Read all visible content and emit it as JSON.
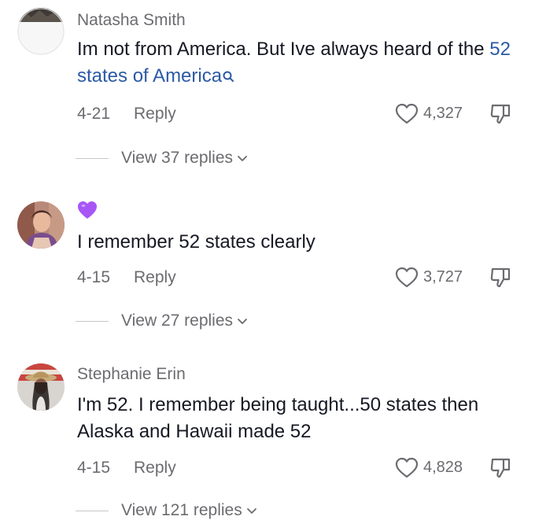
{
  "comments": [
    {
      "username": "Natasha Smith",
      "text_before": "Im not from America. But Ive always heard of the ",
      "link_text": "52 states of America",
      "date": "4-21",
      "reply_label": "Reply",
      "likes": "4,327",
      "view_replies": "View 37 replies"
    },
    {
      "username": "",
      "text": "I remember 52 states clearly",
      "date": "4-15",
      "reply_label": "Reply",
      "likes": "3,727",
      "view_replies": "View 27 replies"
    },
    {
      "username": "Stephanie Erin",
      "text": "I'm 52. I remember being taught...50 states then Alaska and Hawaii made 52",
      "date": "4-15",
      "reply_label": "Reply",
      "likes": "4,828",
      "view_replies": "View 121 replies"
    }
  ],
  "colors": {
    "link": "#2b5aa5",
    "secondary_text": "#6b6b70",
    "primary_text": "#161823",
    "heart_emoji": "#a855f7"
  },
  "icons": {
    "search": "search-icon",
    "like": "heart-icon",
    "dislike": "thumbs-down-icon",
    "expand": "chevron-down-icon",
    "username_emoji": "purple-heart-icon"
  }
}
